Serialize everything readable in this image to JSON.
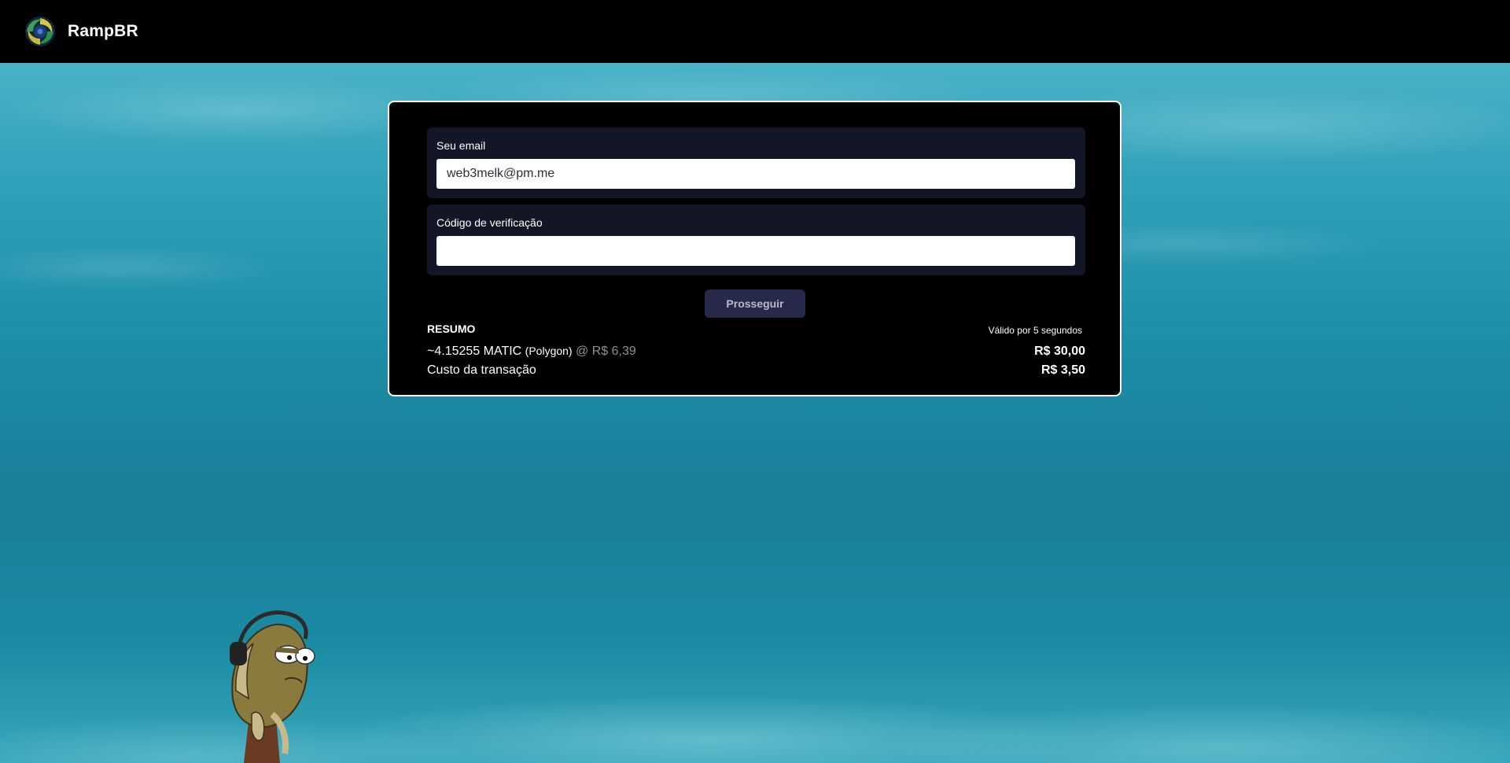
{
  "header": {
    "brand_name": "RampBR",
    "logo_icon": "swirl-logo-icon"
  },
  "form": {
    "email_label": "Seu email",
    "email_value": "web3melk@pm.me",
    "code_label": "Código de verificação",
    "code_value": "",
    "proceed_label": "Prosseguir"
  },
  "summary": {
    "title": "RESUMO",
    "validity": "Válido por 5 segundos",
    "quantity": "~4.15255 MATIC",
    "network": "(Polygon)",
    "rate": "@ R$ 6,39",
    "amount": "R$ 30,00",
    "cost_label": "Custo da transação",
    "cost_value": "R$ 3,50"
  },
  "colors": {
    "accent_button": "#26294a",
    "field_panel": "#121626",
    "ocean": "#1d8ea8"
  },
  "background": {
    "scene": "underwater-ocean",
    "mascot_icon": "fish-with-headphones-icon"
  }
}
